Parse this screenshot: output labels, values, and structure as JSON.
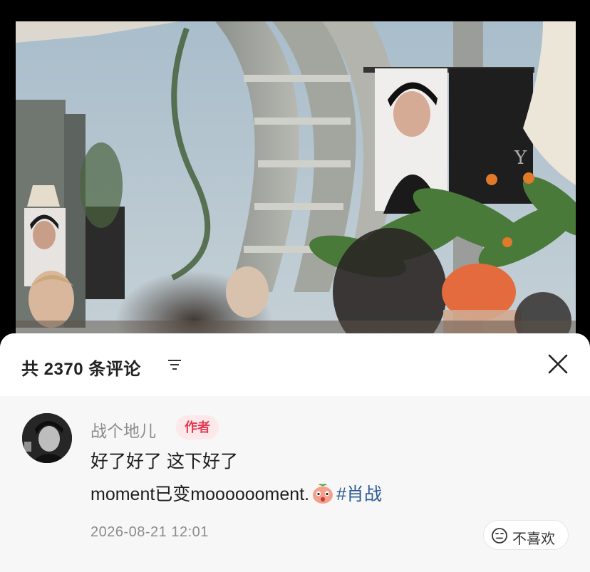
{
  "video": {
    "description": ""
  },
  "comments_panel": {
    "title": "共 2370 条评论",
    "sort_icon": "sort-filter-icon",
    "close_icon": "close-icon"
  },
  "comment": {
    "avatar_icon": "user-avatar",
    "username": "战个地儿",
    "badge": "作者",
    "text_line1": "好了好了 这下好了",
    "text_line2": "moment已变mooooooment.",
    "emoji_icon": "peach-face-emoji",
    "hashtag": "#肖战",
    "timestamp": "2026-08-21 12:01",
    "dislike_label": "不喜欢",
    "dislike_icon": "neutral-face-icon"
  },
  "colors": {
    "badge_text": "#e23c55",
    "badge_bg": "#fde8ea",
    "hashtag": "#2d5a96",
    "muted_text": "#8c8c8c"
  }
}
